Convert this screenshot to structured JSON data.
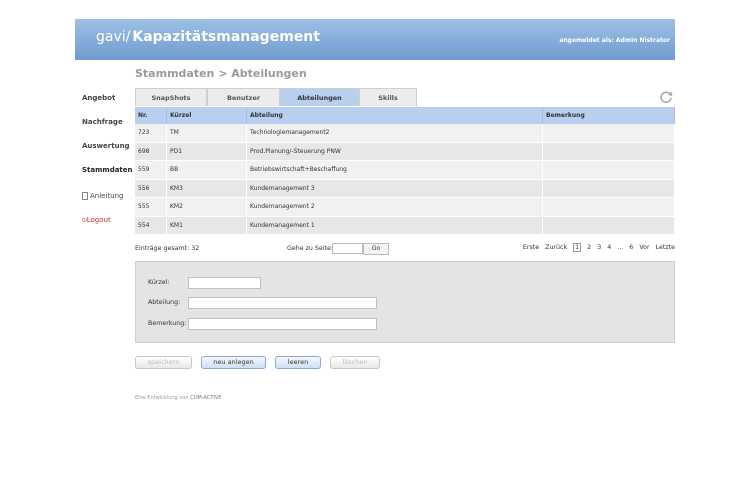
{
  "header": {
    "brand": "gavi/",
    "title": "Kapazitätsmanagement",
    "user": "angemeldet als: Admin Nistrator"
  },
  "sidebar": {
    "items": [
      {
        "label": "Angebot"
      },
      {
        "label": "Nachfrage"
      },
      {
        "label": "Auswertung"
      },
      {
        "label": "Stammdaten"
      },
      {
        "label": "Anleitung"
      },
      {
        "label": "Logout"
      }
    ]
  },
  "page_title": "Stammdaten > Abteilungen",
  "tabs": [
    {
      "label": "SnapShots"
    },
    {
      "label": "Benutzer"
    },
    {
      "label": "Abteilungen",
      "active": true
    },
    {
      "label": "Skills"
    }
  ],
  "table": {
    "columns": [
      "Nr.",
      "Kürzel",
      "Abteilung",
      "Bemerkung"
    ],
    "rows": [
      [
        "723",
        "TM",
        "Technologiemanagement2",
        ""
      ],
      [
        "698",
        "PD1",
        "Prod.Planung/-Steuerung PNW",
        ""
      ],
      [
        "559",
        "BB",
        "Betriebswirtschaft+Beschaffung",
        ""
      ],
      [
        "556",
        "KM3",
        "Kundemanagement 3",
        ""
      ],
      [
        "555",
        "KM2",
        "Kundemanagement 2",
        ""
      ],
      [
        "554",
        "KM1",
        "Kundemanagement 1",
        ""
      ]
    ]
  },
  "pager": {
    "total": "Einträge gesamt: 32",
    "goto_label": "Gehe zu Seite:",
    "go_button": "Go",
    "first": "Erste",
    "back": "Zurück",
    "pages": [
      "1",
      "2",
      "3",
      "4",
      "...",
      "6"
    ],
    "current_page": "1",
    "next": "Vor",
    "last": "Letzte"
  },
  "form": {
    "kuerzel_label": "Kürzel:",
    "abteilung_label": "Abteilung:",
    "bemerkung_label": "Bemerkung:"
  },
  "buttons": {
    "save": "speichern",
    "new": "neu anlegen",
    "clear": "leeren",
    "delete": "löschen"
  },
  "footer": {
    "text": "Eine Entwicklung von",
    "company": "COM-ACTIVE"
  },
  "colors": {
    "header_top": "#9fc0e4",
    "header_bottom": "#6f9bd0",
    "active_tab": "#b8cff0",
    "logout": "#cc2a2a"
  },
  "icons": {
    "refresh": "refresh-icon",
    "anleitung": "document-icon",
    "logout": "power-icon"
  }
}
